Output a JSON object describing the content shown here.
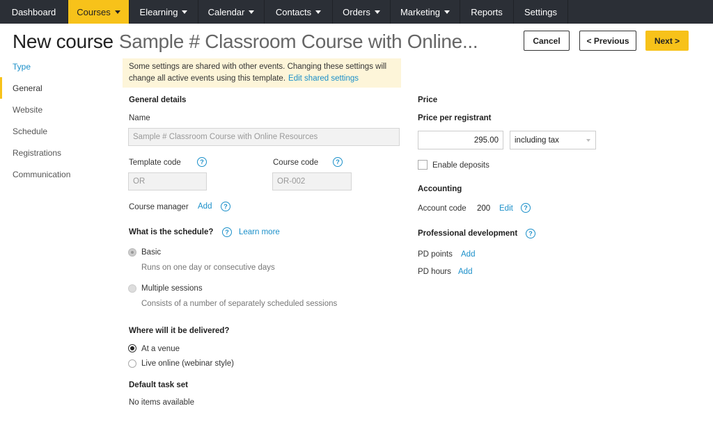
{
  "nav": {
    "items": [
      {
        "label": "Dashboard",
        "dropdown": false
      },
      {
        "label": "Courses",
        "dropdown": true,
        "active": true
      },
      {
        "label": "Elearning",
        "dropdown": true
      },
      {
        "label": "Calendar",
        "dropdown": true
      },
      {
        "label": "Contacts",
        "dropdown": true
      },
      {
        "label": "Orders",
        "dropdown": true
      },
      {
        "label": "Marketing",
        "dropdown": true
      },
      {
        "label": "Reports",
        "dropdown": false
      },
      {
        "label": "Settings",
        "dropdown": false
      }
    ],
    "accent": "#f7c21a"
  },
  "header": {
    "title": "New course",
    "subtitle": "Sample # Classroom Course with Online...",
    "cancel_label": "Cancel",
    "previous_label": "< Previous",
    "next_label": "Next >"
  },
  "sidebar": {
    "items": [
      {
        "label": "Type"
      },
      {
        "label": "General"
      },
      {
        "label": "Website"
      },
      {
        "label": "Schedule"
      },
      {
        "label": "Registrations"
      },
      {
        "label": "Communication"
      }
    ]
  },
  "notice": {
    "text": "Some settings are shared with other events. Changing these settings will change all active events using this template.",
    "link": "Edit shared settings"
  },
  "general": {
    "heading": "General details",
    "name_label": "Name",
    "name_value": "Sample # Classroom Course with Online Resources",
    "template_code_label": "Template code",
    "template_code_value": "OR",
    "course_code_label": "Course code",
    "course_code_value": "OR-002",
    "course_manager_label": "Course manager",
    "course_manager_add": "Add"
  },
  "schedule": {
    "question": "What is the schedule?",
    "learn_more": "Learn more",
    "basic_label": "Basic",
    "basic_desc": "Runs on one day or consecutive days",
    "multiple_label": "Multiple sessions",
    "multiple_desc": "Consists of a number of separately scheduled sessions"
  },
  "delivery": {
    "question": "Where will it be delivered?",
    "venue_label": "At a venue",
    "online_label": "Live online (webinar style)"
  },
  "tasks": {
    "heading": "Default task set",
    "empty": "No items available"
  },
  "price": {
    "heading": "Price",
    "per_registrant_label": "Price per registrant",
    "amount": "295.00",
    "tax_option": "including tax",
    "deposits_label": "Enable deposits"
  },
  "accounting": {
    "heading": "Accounting",
    "account_code_label": "Account code",
    "account_code_value": "200",
    "edit": "Edit"
  },
  "pd": {
    "heading": "Professional development",
    "points_label": "PD points",
    "points_add": "Add",
    "hours_label": "PD hours",
    "hours_add": "Add"
  }
}
